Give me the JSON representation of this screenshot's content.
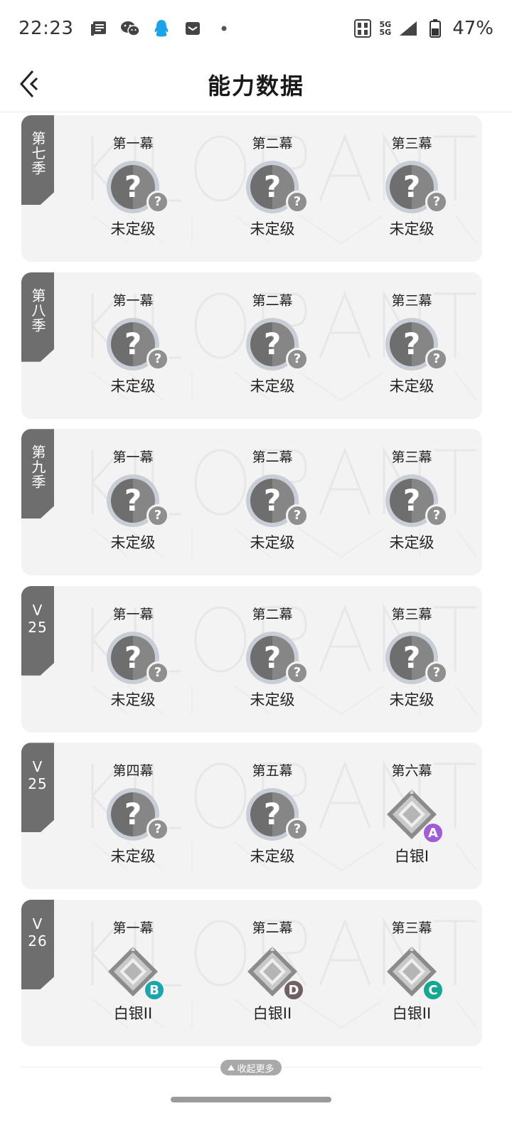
{
  "status_bar": {
    "time": "22:23",
    "notification_icons": [
      "news-icon",
      "wechat-icon",
      "qq-icon",
      "mail-icon",
      "dot-icon"
    ],
    "network_top": "5G",
    "network_bottom": "5G",
    "battery_percent": "47%"
  },
  "header": {
    "title": "能力数据"
  },
  "colors": {
    "card_bg": "#f3f3f3",
    "tag_bg": "#6e6e6e",
    "tier_A": "#a05bd6",
    "tier_B": "#1ba6ad",
    "tier_C": "#14a892",
    "tier_D": "#6f6062"
  },
  "seasons": [
    {
      "tag": "第七季",
      "acts": [
        {
          "name": "第一幕",
          "rank": "未定级",
          "icon": "unknown-rank-icon"
        },
        {
          "name": "第二幕",
          "rank": "未定级",
          "icon": "unknown-rank-icon"
        },
        {
          "name": "第三幕",
          "rank": "未定级",
          "icon": "unknown-rank-icon"
        }
      ]
    },
    {
      "tag": "第八季",
      "acts": [
        {
          "name": "第一幕",
          "rank": "未定级",
          "icon": "unknown-rank-icon"
        },
        {
          "name": "第二幕",
          "rank": "未定级",
          "icon": "unknown-rank-icon"
        },
        {
          "name": "第三幕",
          "rank": "未定级",
          "icon": "unknown-rank-icon"
        }
      ]
    },
    {
      "tag": "第九季",
      "acts": [
        {
          "name": "第一幕",
          "rank": "未定级",
          "icon": "unknown-rank-icon"
        },
        {
          "name": "第二幕",
          "rank": "未定级",
          "icon": "unknown-rank-icon"
        },
        {
          "name": "第三幕",
          "rank": "未定级",
          "icon": "unknown-rank-icon"
        }
      ]
    },
    {
      "tag": "V\n25",
      "acts": [
        {
          "name": "第一幕",
          "rank": "未定级",
          "icon": "unknown-rank-icon"
        },
        {
          "name": "第二幕",
          "rank": "未定级",
          "icon": "unknown-rank-icon"
        },
        {
          "name": "第三幕",
          "rank": "未定级",
          "icon": "unknown-rank-icon"
        }
      ]
    },
    {
      "tag": "V\n25",
      "acts": [
        {
          "name": "第四幕",
          "rank": "未定级",
          "icon": "unknown-rank-icon"
        },
        {
          "name": "第五幕",
          "rank": "未定级",
          "icon": "unknown-rank-icon"
        },
        {
          "name": "第六幕",
          "rank": "白银I",
          "icon": "silver-rank-icon",
          "tier": "A"
        }
      ]
    },
    {
      "tag": "V\n26",
      "acts": [
        {
          "name": "第一幕",
          "rank": "白银II",
          "icon": "silver-rank-icon",
          "tier": "B"
        },
        {
          "name": "第二幕",
          "rank": "白银II",
          "icon": "silver-rank-icon",
          "tier": "D"
        },
        {
          "name": "第三幕",
          "rank": "白银II",
          "icon": "silver-rank-icon",
          "tier": "C"
        }
      ]
    }
  ],
  "collapse": {
    "label": "收起更多"
  }
}
